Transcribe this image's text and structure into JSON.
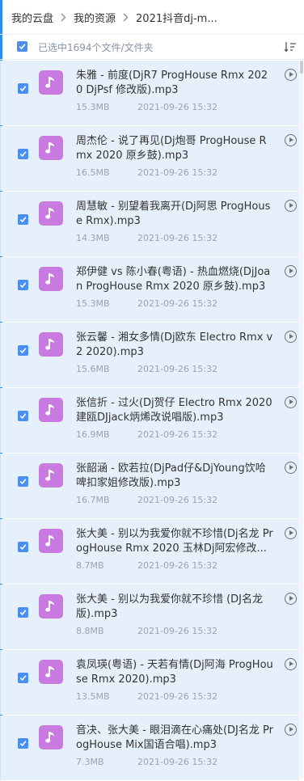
{
  "breadcrumb": {
    "items": [
      "我的云盘",
      "我的资源",
      "2021抖音dj-m..."
    ]
  },
  "toolbar": {
    "selection_text": "已选中1694个文件/文件夹"
  },
  "files": [
    {
      "name": "朱雅 - 前度(DjR7 ProgHouse Rmx 2020 DjPsf 修改版).mp3",
      "size": "15.3MB",
      "date": "2021-09-26 15:32"
    },
    {
      "name": "周杰伦 - 说了再见(Dj炮哥 ProgHouse Rmx 2020 原乡鼓).mp3",
      "size": "16.5MB",
      "date": "2021-09-26 15:32"
    },
    {
      "name": "周慧敏 - 别望着我离开(Dj阿思 ProgHouse Rmx).mp3",
      "size": "14.3MB",
      "date": "2021-09-26 15:32"
    },
    {
      "name": "郑伊健 vs 陈小春(粤语) - 热血燃烧(DjJoan ProgHouse Rmx 2020 原乡鼓).mp3",
      "size": "15.3MB",
      "date": "2021-09-26 15:32"
    },
    {
      "name": "张云馨 - 湘女多情(Dj欧东 Electro Rmx v2 2020).mp3",
      "size": "15.6MB",
      "date": "2021-09-26 15:32"
    },
    {
      "name": "张信折 - 过火(Dj贺仔 Electro Rmx 2020 建瓯DJjack炳烯改说唱版).mp3",
      "size": "16.9MB",
      "date": "2021-09-26 15:32"
    },
    {
      "name": "张韶涵 - 欧若拉(DjPad仔&DjYoung饮哈啤扣家姐修改版).mp3",
      "size": "16.7MB",
      "date": "2021-09-26 15:32"
    },
    {
      "name": "张大美 - 别以为我爱你就不珍惜(Dj名龙 ProgHouse Rmx 2020 玉林Dj阿宏修改...",
      "size": "8.7MB",
      "date": "2021-09-26 15:32"
    },
    {
      "name": "张大美 - 别以为我爱你就不珍惜 (DJ名龙版).mp3",
      "size": "8.8MB",
      "date": "2021-09-26 15:32"
    },
    {
      "name": "袁凤瑛(粤语) - 天若有情(Dj阿海 ProgHouse Rmx 2020).mp3",
      "size": "13.5MB",
      "date": "2021-09-26 15:32"
    },
    {
      "name": "音决、张大美 - 眼泪滴在心痛处(DJ名龙 ProgHouse Mix国语合唱).mp3",
      "size": "7.3MB",
      "date": "2021-09-26 15:32"
    }
  ],
  "colors": {
    "accent": "#4a8ff0",
    "row_background": "#e6f0fb",
    "music_icon": "#c87ae0"
  },
  "icons": {
    "breadcrumb_separator": "chevron-right-icon",
    "sort": "sort-icon",
    "file": "music-note-icon",
    "action": "play-circle-icon"
  }
}
